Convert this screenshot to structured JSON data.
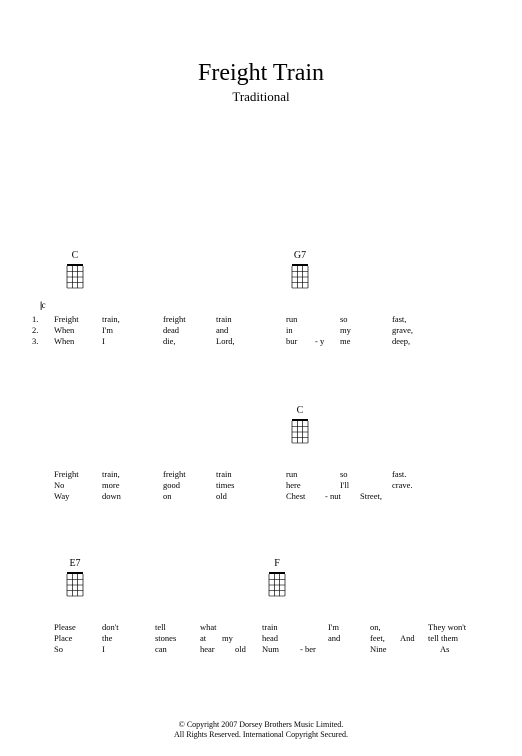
{
  "header": {
    "title": "Freight Train",
    "subtitle": "Traditional"
  },
  "chords": {
    "C": "C",
    "G7": "G7",
    "E7": "E7",
    "F": "F"
  },
  "barline": "||c",
  "verse_numbers": [
    "1.",
    "2.",
    "3."
  ],
  "system1": {
    "line1": {
      "s1": "Freight",
      "s2": "train,",
      "s3": "freight",
      "s4": "train",
      "s5": "run",
      "s6": "so",
      "s7": "fast,"
    },
    "line2": {
      "s1": "When",
      "s2": "I'm",
      "s3": "dead",
      "s4": "and",
      "s5": "in",
      "s6": "my",
      "s7": "grave,"
    },
    "line3": {
      "s1": "When",
      "s2": "I",
      "s3": "die,",
      "s4": "Lord,",
      "s5": "bur",
      "s6": "- y",
      "s7": "me",
      "s8": "deep,"
    }
  },
  "system2": {
    "line1": {
      "s1": "Freight",
      "s2": "train,",
      "s3": "freight",
      "s4": "train",
      "s5": "run",
      "s6": "so",
      "s7": "fast."
    },
    "line2": {
      "s1": "No",
      "s2": "more",
      "s3": "good",
      "s4": "times",
      "s5": "here",
      "s6": "I'll",
      "s7": "crave."
    },
    "line3": {
      "s1": "Way",
      "s2": "down",
      "s3": "on",
      "s4": "old",
      "s5": "Chest",
      "s6": "- nut",
      "s7": "Street,"
    }
  },
  "system3": {
    "line1": {
      "s1": "Please",
      "s2": "don't",
      "s3": "tell",
      "s4": "what",
      "s5": "train",
      "s6": "I'm",
      "s7": "on,",
      "s8": "They won't"
    },
    "line2": {
      "s1": "Place",
      "s2": "the",
      "s3": "stones",
      "s4": "at",
      "s5": "my",
      "s6": "head",
      "s7": "and",
      "s8": "feet,",
      "s9": "And",
      "s10": "tell them"
    },
    "line3": {
      "s1": "So",
      "s2": "I",
      "s3": "can",
      "s4": "hear",
      "s5": "old",
      "s6": "Num",
      "s7": "- ber",
      "s8": "Nine",
      "s9": "As"
    }
  },
  "footer": {
    "line1": "© Copyright 2007 Dorsey Brothers Music Limited.",
    "line2": "All Rights Reserved. International Copyright Secured."
  }
}
